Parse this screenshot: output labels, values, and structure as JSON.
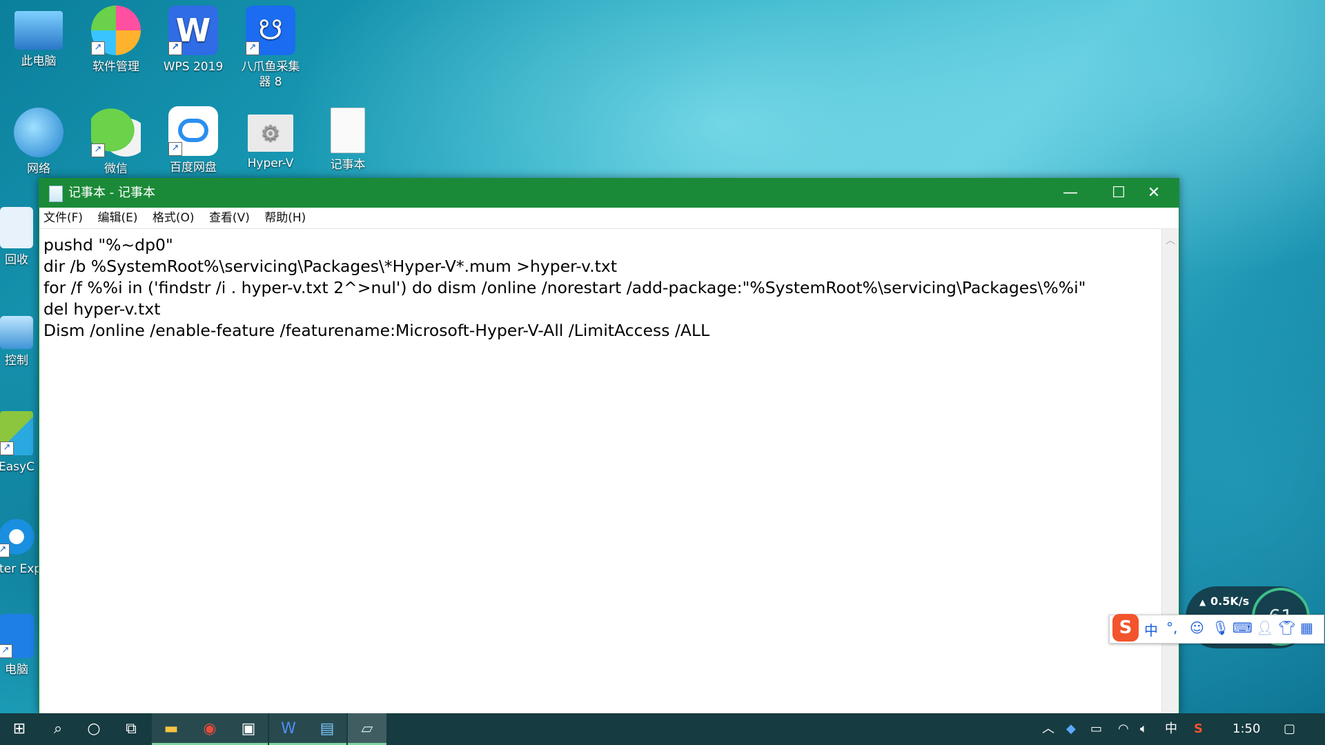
{
  "desktop": {
    "icons": [
      {
        "label": "此电脑"
      },
      {
        "label": "软件管理"
      },
      {
        "label": "WPS 2019"
      },
      {
        "label": "八爪鱼采集器 8"
      },
      {
        "label": "网络"
      },
      {
        "label": "微信"
      },
      {
        "label": "百度网盘"
      },
      {
        "label": "Hyper-V"
      },
      {
        "label": "记事本"
      },
      {
        "label": "回收"
      },
      {
        "label": "控制"
      },
      {
        "label": "EasyC"
      },
      {
        "label": "Inter Expl"
      },
      {
        "label": "电脑"
      }
    ]
  },
  "window": {
    "title": "记事本 - 记事本",
    "minimize": "—",
    "maximize": "☐",
    "close": "✕",
    "menu": [
      "文件(F)",
      "编辑(E)",
      "格式(O)",
      "查看(V)",
      "帮助(H)"
    ],
    "content": "pushd \"%~dp0\"\ndir /b %SystemRoot%\\servicing\\Packages\\*Hyper-V*.mum >hyper-v.txt\nfor /f %%i in ('findstr /i . hyper-v.txt 2^>nul') do dism /online /norestart /add-package:\"%SystemRoot%\\servicing\\Packages\\%%i\"\ndel hyper-v.txt\nDism /online /enable-feature /featurename:Microsoft-Hyper-V-All /LimitAccess /ALL"
  },
  "ime": {
    "lang": "中",
    "punct": "°,",
    "net_speed": "0.5K/s",
    "percent": "61"
  },
  "taskbar": {
    "tray_lang": "中",
    "clock": "1:50"
  },
  "colors": {
    "titlebar": "#1b8a38",
    "taskbar": "#163b40"
  }
}
